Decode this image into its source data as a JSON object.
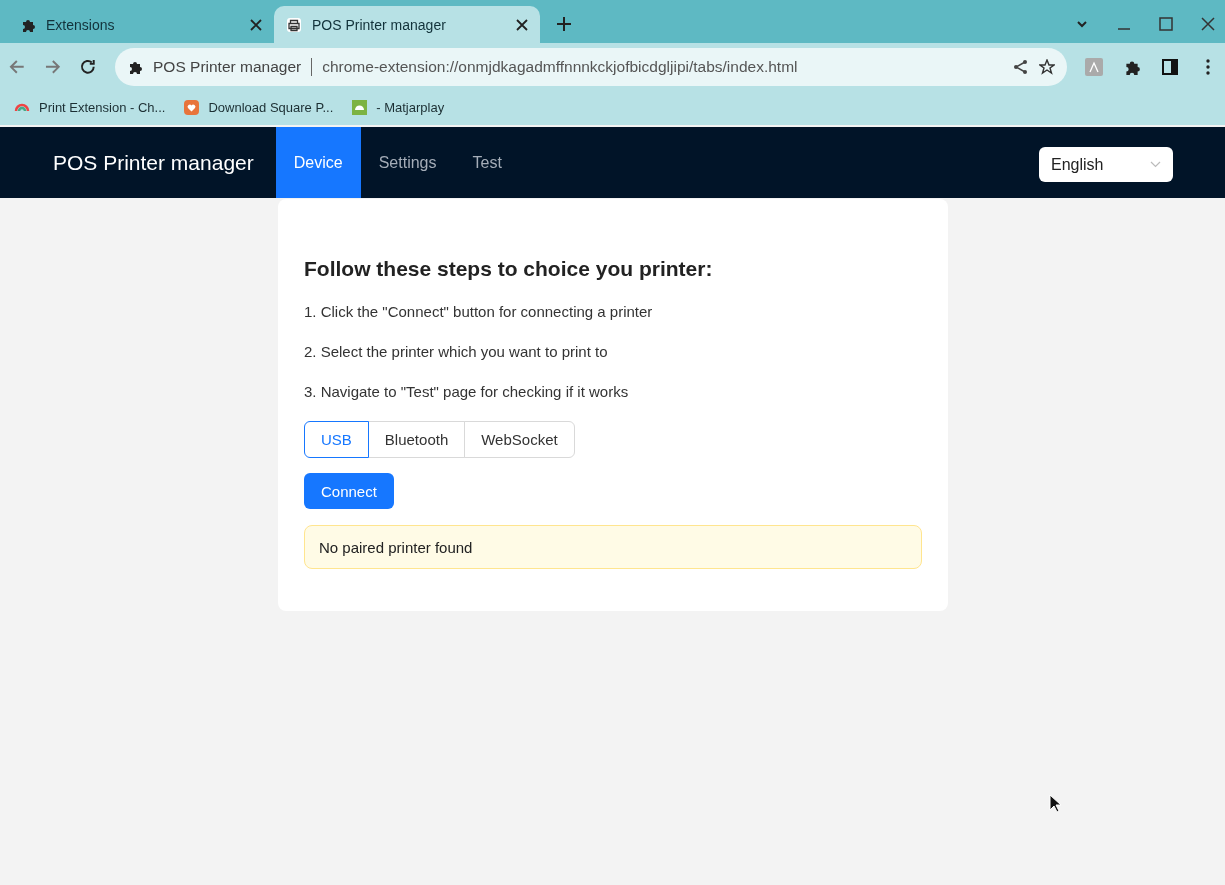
{
  "browser": {
    "tabs": [
      {
        "title": "Extensions",
        "selected": false
      },
      {
        "title": "POS Printer manager",
        "selected": true
      }
    ],
    "address": {
      "site_name": "POS Printer manager",
      "url": "chrome-extension://onmjdkagadmffnnnkckjofbicdgljipi/tabs/index.html"
    },
    "bookmarks": [
      {
        "label": "Print Extension - Ch..."
      },
      {
        "label": "Download Square P..."
      },
      {
        "label": "- Matjarplay"
      }
    ]
  },
  "app": {
    "title": "POS Printer manager",
    "nav": [
      {
        "label": "Device",
        "selected": true
      },
      {
        "label": "Settings",
        "selected": false
      },
      {
        "label": "Test",
        "selected": false
      }
    ],
    "language": {
      "value": "English"
    }
  },
  "card": {
    "heading": "Follow these steps to choice you printer:",
    "steps": [
      "1. Click the \"Connect\" button for connecting a printer",
      "2. Select the printer which you want to print to",
      "3. Navigate to \"Test\" page for checking if it works"
    ],
    "connection_types": [
      {
        "label": "USB",
        "selected": true
      },
      {
        "label": "Bluetooth",
        "selected": false
      },
      {
        "label": "WebSocket",
        "selected": false
      }
    ],
    "connect_button": "Connect",
    "alert": "No paired printer found"
  }
}
